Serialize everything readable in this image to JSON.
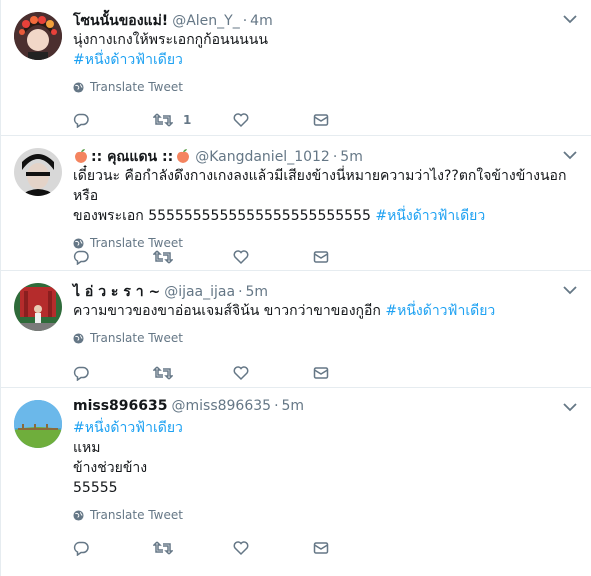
{
  "tweets": [
    {
      "name": "โซนนั้นของแม่!",
      "handle": "@Alen_Y_",
      "time": "4m",
      "lines": [
        "นุ่งกางเกงให้พระเอกกูก้อนนนนน"
      ],
      "hashtag": "#หนึ่งด้าวฟ้าเดียว",
      "translate": "Translate Tweet",
      "retweets": "1"
    },
    {
      "name_prefix_icon": "peach",
      "name": ":: คุณแดน ::",
      "handle": "@Kangdaniel_1012",
      "time": "5m",
      "line1": "เดี๋ยวนะ คือกำลังดึงกางเกงลงแล้วมีเสียงข้างนี่หมายความว่าไง??ตกใจข้างข้างนอกหรือ",
      "line2": "ของพระเอก 5555555555555555555555555",
      "hashtag": "#หนึ่งด้าวฟ้าเดียว",
      "translate": "Translate Tweet"
    },
    {
      "name": "ไ อ่ ว ะ ร า ~",
      "handle": "@ijaa_ijaa",
      "time": "5m",
      "line1": "ความขาวของขาอ่อนเจมส์จิน้น ขาวกว่าขาของกูอีก",
      "hashtag": "#หนึ่งด้าวฟ้าเดียว",
      "translate": "Translate Tweet"
    },
    {
      "name": "miss896635",
      "handle": "@miss896635",
      "time": "5m",
      "hashtag": "#หนึ่งด้าวฟ้าเดียว",
      "lines": [
        "แหม",
        "ข้างช่วยข้าง",
        "55555"
      ],
      "translate": "Translate Tweet"
    }
  ],
  "separator": "·",
  "colors": {
    "link": "#1da1f2",
    "muted": "#657786",
    "divider": "#e6ecf0",
    "text": "#14171a"
  }
}
